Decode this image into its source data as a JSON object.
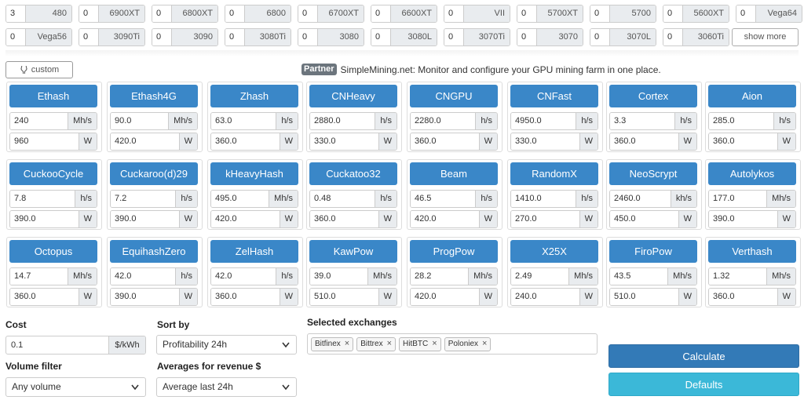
{
  "gpus_row1": [
    {
      "count": "3",
      "label": "480"
    },
    {
      "count": "0",
      "label": "6900XT"
    },
    {
      "count": "0",
      "label": "6800XT"
    },
    {
      "count": "0",
      "label": "6800"
    },
    {
      "count": "0",
      "label": "6700XT"
    },
    {
      "count": "0",
      "label": "6600XT"
    },
    {
      "count": "0",
      "label": "VII"
    },
    {
      "count": "0",
      "label": "5700XT"
    },
    {
      "count": "0",
      "label": "5700"
    },
    {
      "count": "0",
      "label": "5600XT"
    },
    {
      "count": "0",
      "label": "Vega64"
    }
  ],
  "gpus_row2": [
    {
      "count": "0",
      "label": "Vega56"
    },
    {
      "count": "0",
      "label": "3090Ti"
    },
    {
      "count": "0",
      "label": "3090"
    },
    {
      "count": "0",
      "label": "3080Ti"
    },
    {
      "count": "0",
      "label": "3080"
    },
    {
      "count": "0",
      "label": "3080L"
    },
    {
      "count": "0",
      "label": "3070Ti"
    },
    {
      "count": "0",
      "label": "3070"
    },
    {
      "count": "0",
      "label": "3070L"
    },
    {
      "count": "0",
      "label": "3060Ti"
    }
  ],
  "show_more_label": "show more",
  "custom_label": "custom",
  "partner": {
    "badge": "Partner",
    "text": "SimpleMining.net: Monitor and configure your GPU mining farm in one place."
  },
  "algos": [
    {
      "name": "Ethash",
      "hashrate": "240",
      "unit": "Mh/s",
      "power": "960",
      "power_unit": "W"
    },
    {
      "name": "Ethash4G",
      "hashrate": "90.0",
      "unit": "Mh/s",
      "power": "420.0",
      "power_unit": "W"
    },
    {
      "name": "Zhash",
      "hashrate": "63.0",
      "unit": "h/s",
      "power": "360.0",
      "power_unit": "W"
    },
    {
      "name": "CNHeavy",
      "hashrate": "2880.0",
      "unit": "h/s",
      "power": "330.0",
      "power_unit": "W"
    },
    {
      "name": "CNGPU",
      "hashrate": "2280.0",
      "unit": "h/s",
      "power": "360.0",
      "power_unit": "W"
    },
    {
      "name": "CNFast",
      "hashrate": "4950.0",
      "unit": "h/s",
      "power": "330.0",
      "power_unit": "W"
    },
    {
      "name": "Cortex",
      "hashrate": "3.3",
      "unit": "h/s",
      "power": "360.0",
      "power_unit": "W"
    },
    {
      "name": "Aion",
      "hashrate": "285.0",
      "unit": "h/s",
      "power": "360.0",
      "power_unit": "W"
    },
    {
      "name": "CuckooCycle",
      "hashrate": "7.8",
      "unit": "h/s",
      "power": "390.0",
      "power_unit": "W"
    },
    {
      "name": "Cuckaroo(d)29",
      "hashrate": "7.2",
      "unit": "h/s",
      "power": "390.0",
      "power_unit": "W"
    },
    {
      "name": "kHeavyHash",
      "hashrate": "495.0",
      "unit": "Mh/s",
      "power": "420.0",
      "power_unit": "W"
    },
    {
      "name": "Cuckatoo32",
      "hashrate": "0.48",
      "unit": "h/s",
      "power": "360.0",
      "power_unit": "W"
    },
    {
      "name": "Beam",
      "hashrate": "46.5",
      "unit": "h/s",
      "power": "420.0",
      "power_unit": "W"
    },
    {
      "name": "RandomX",
      "hashrate": "1410.0",
      "unit": "h/s",
      "power": "270.0",
      "power_unit": "W"
    },
    {
      "name": "NeoScrypt",
      "hashrate": "2460.0",
      "unit": "kh/s",
      "power": "450.0",
      "power_unit": "W"
    },
    {
      "name": "Autolykos",
      "hashrate": "177.0",
      "unit": "Mh/s",
      "power": "390.0",
      "power_unit": "W"
    },
    {
      "name": "Octopus",
      "hashrate": "14.7",
      "unit": "Mh/s",
      "power": "360.0",
      "power_unit": "W"
    },
    {
      "name": "EquihashZero",
      "hashrate": "42.0",
      "unit": "h/s",
      "power": "390.0",
      "power_unit": "W"
    },
    {
      "name": "ZelHash",
      "hashrate": "42.0",
      "unit": "h/s",
      "power": "360.0",
      "power_unit": "W"
    },
    {
      "name": "KawPow",
      "hashrate": "39.0",
      "unit": "Mh/s",
      "power": "510.0",
      "power_unit": "W"
    },
    {
      "name": "ProgPow",
      "hashrate": "28.2",
      "unit": "Mh/s",
      "power": "420.0",
      "power_unit": "W"
    },
    {
      "name": "X25X",
      "hashrate": "2.49",
      "unit": "Mh/s",
      "power": "240.0",
      "power_unit": "W"
    },
    {
      "name": "FiroPow",
      "hashrate": "43.5",
      "unit": "Mh/s",
      "power": "510.0",
      "power_unit": "W"
    },
    {
      "name": "Verthash",
      "hashrate": "1.32",
      "unit": "Mh/s",
      "power": "360.0",
      "power_unit": "W"
    }
  ],
  "cost": {
    "label": "Cost",
    "value": "0.1",
    "unit": "$/kWh"
  },
  "sort_by": {
    "label": "Sort by",
    "value": "Profitability 24h"
  },
  "volume_filter": {
    "label": "Volume filter",
    "value": "Any volume"
  },
  "averages": {
    "label": "Averages for revenue $",
    "value": "Average last 24h"
  },
  "exchanges": {
    "label": "Selected exchanges",
    "items": [
      "Bitfinex",
      "Bittrex",
      "HitBTC",
      "Poloniex"
    ]
  },
  "calculate_label": "Calculate",
  "defaults_label": "Defaults",
  "colors": {
    "primary": "#337ab7",
    "algo_button": "#3a87c8",
    "info": "#3bb8d8"
  }
}
